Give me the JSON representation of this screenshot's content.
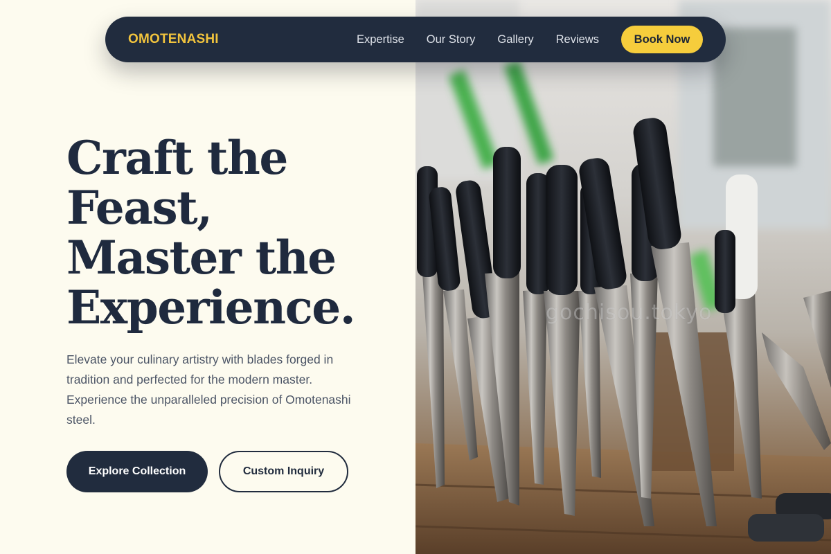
{
  "nav": {
    "logo": "OMOTENASHI",
    "links": [
      "Expertise",
      "Our Story",
      "Gallery",
      "Reviews"
    ],
    "cta": "Book Now"
  },
  "hero": {
    "title_lines": [
      "Craft the",
      "Feast,",
      "Master the",
      "Experience."
    ],
    "description": "Elevate your culinary artistry with blades forged in tradition and perfected for the modern master. Experience the unparalleled precision of Omotenashi steel.",
    "primary_button": "Explore Collection",
    "secondary_button": "Custom Inquiry"
  },
  "image": {
    "subject": "knives-display-photo",
    "watermark": "gochisou.tokyo"
  },
  "colors": {
    "background": "#fdfbef",
    "navy": "#212c3e",
    "accent_yellow": "#f6cd3c",
    "logo_yellow": "#f2c43d",
    "body_text": "#4c5566"
  }
}
